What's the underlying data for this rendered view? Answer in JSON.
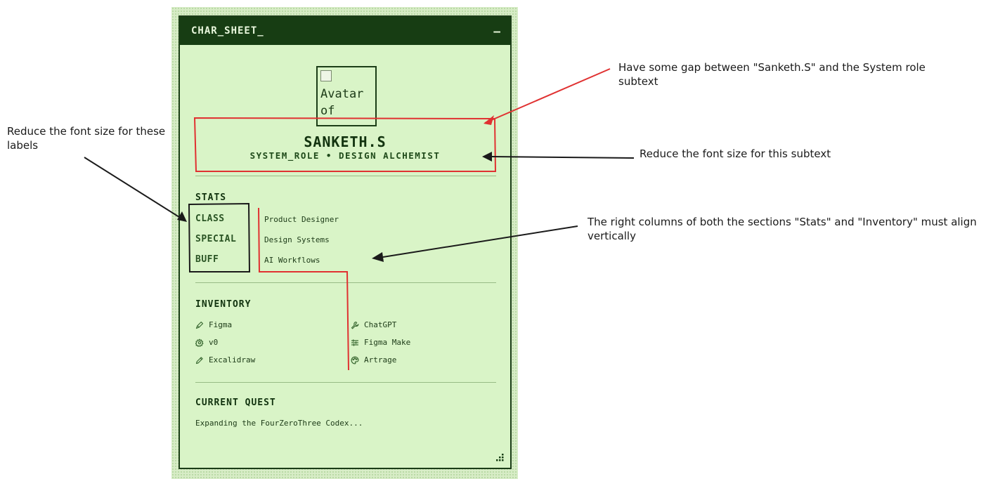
{
  "window": {
    "title": "CHAR_SHEET_",
    "minimize_label": "–"
  },
  "profile": {
    "avatar_alt_line1": "Avatar",
    "avatar_alt_line2": "of",
    "name": "SANKETH.S",
    "role": "SYSTEM_ROLE • DESIGN ALCHEMIST"
  },
  "stats": {
    "title": "STATS",
    "rows": [
      {
        "label": "CLASS",
        "value": "Product Designer"
      },
      {
        "label": "SPECIAL",
        "value": "Design Systems"
      },
      {
        "label": "BUFF",
        "value": "AI Workflows"
      }
    ]
  },
  "inventory": {
    "title": "INVENTORY",
    "items": [
      {
        "label": "Figma",
        "icon": "pen-icon"
      },
      {
        "label": "ChatGPT",
        "icon": "wrench-icon"
      },
      {
        "label": "v0",
        "icon": "gear-icon"
      },
      {
        "label": "Figma Make",
        "icon": "sliders-icon"
      },
      {
        "label": "Excalidraw",
        "icon": "pencil-icon"
      },
      {
        "label": "Artrage",
        "icon": "palette-icon"
      }
    ]
  },
  "quest": {
    "title": "CURRENT QUEST",
    "text": "Expanding the FourZeroThree Codex..."
  },
  "annotations": {
    "gap_note": "Have some gap between \"Sanketh.S\" and the System role subtext",
    "subtext_note": "Reduce the font size for this subtext",
    "labels_note": "Reduce the font size for these labels",
    "align_note": "The right columns of both the sections \"Stats\" and \"Inventory\" must align vertically"
  },
  "colors": {
    "header_bg": "#173d13",
    "card_bg": "#d9f4c7",
    "annotation_red": "#e03131",
    "annotation_black": "#1a1a1a"
  }
}
